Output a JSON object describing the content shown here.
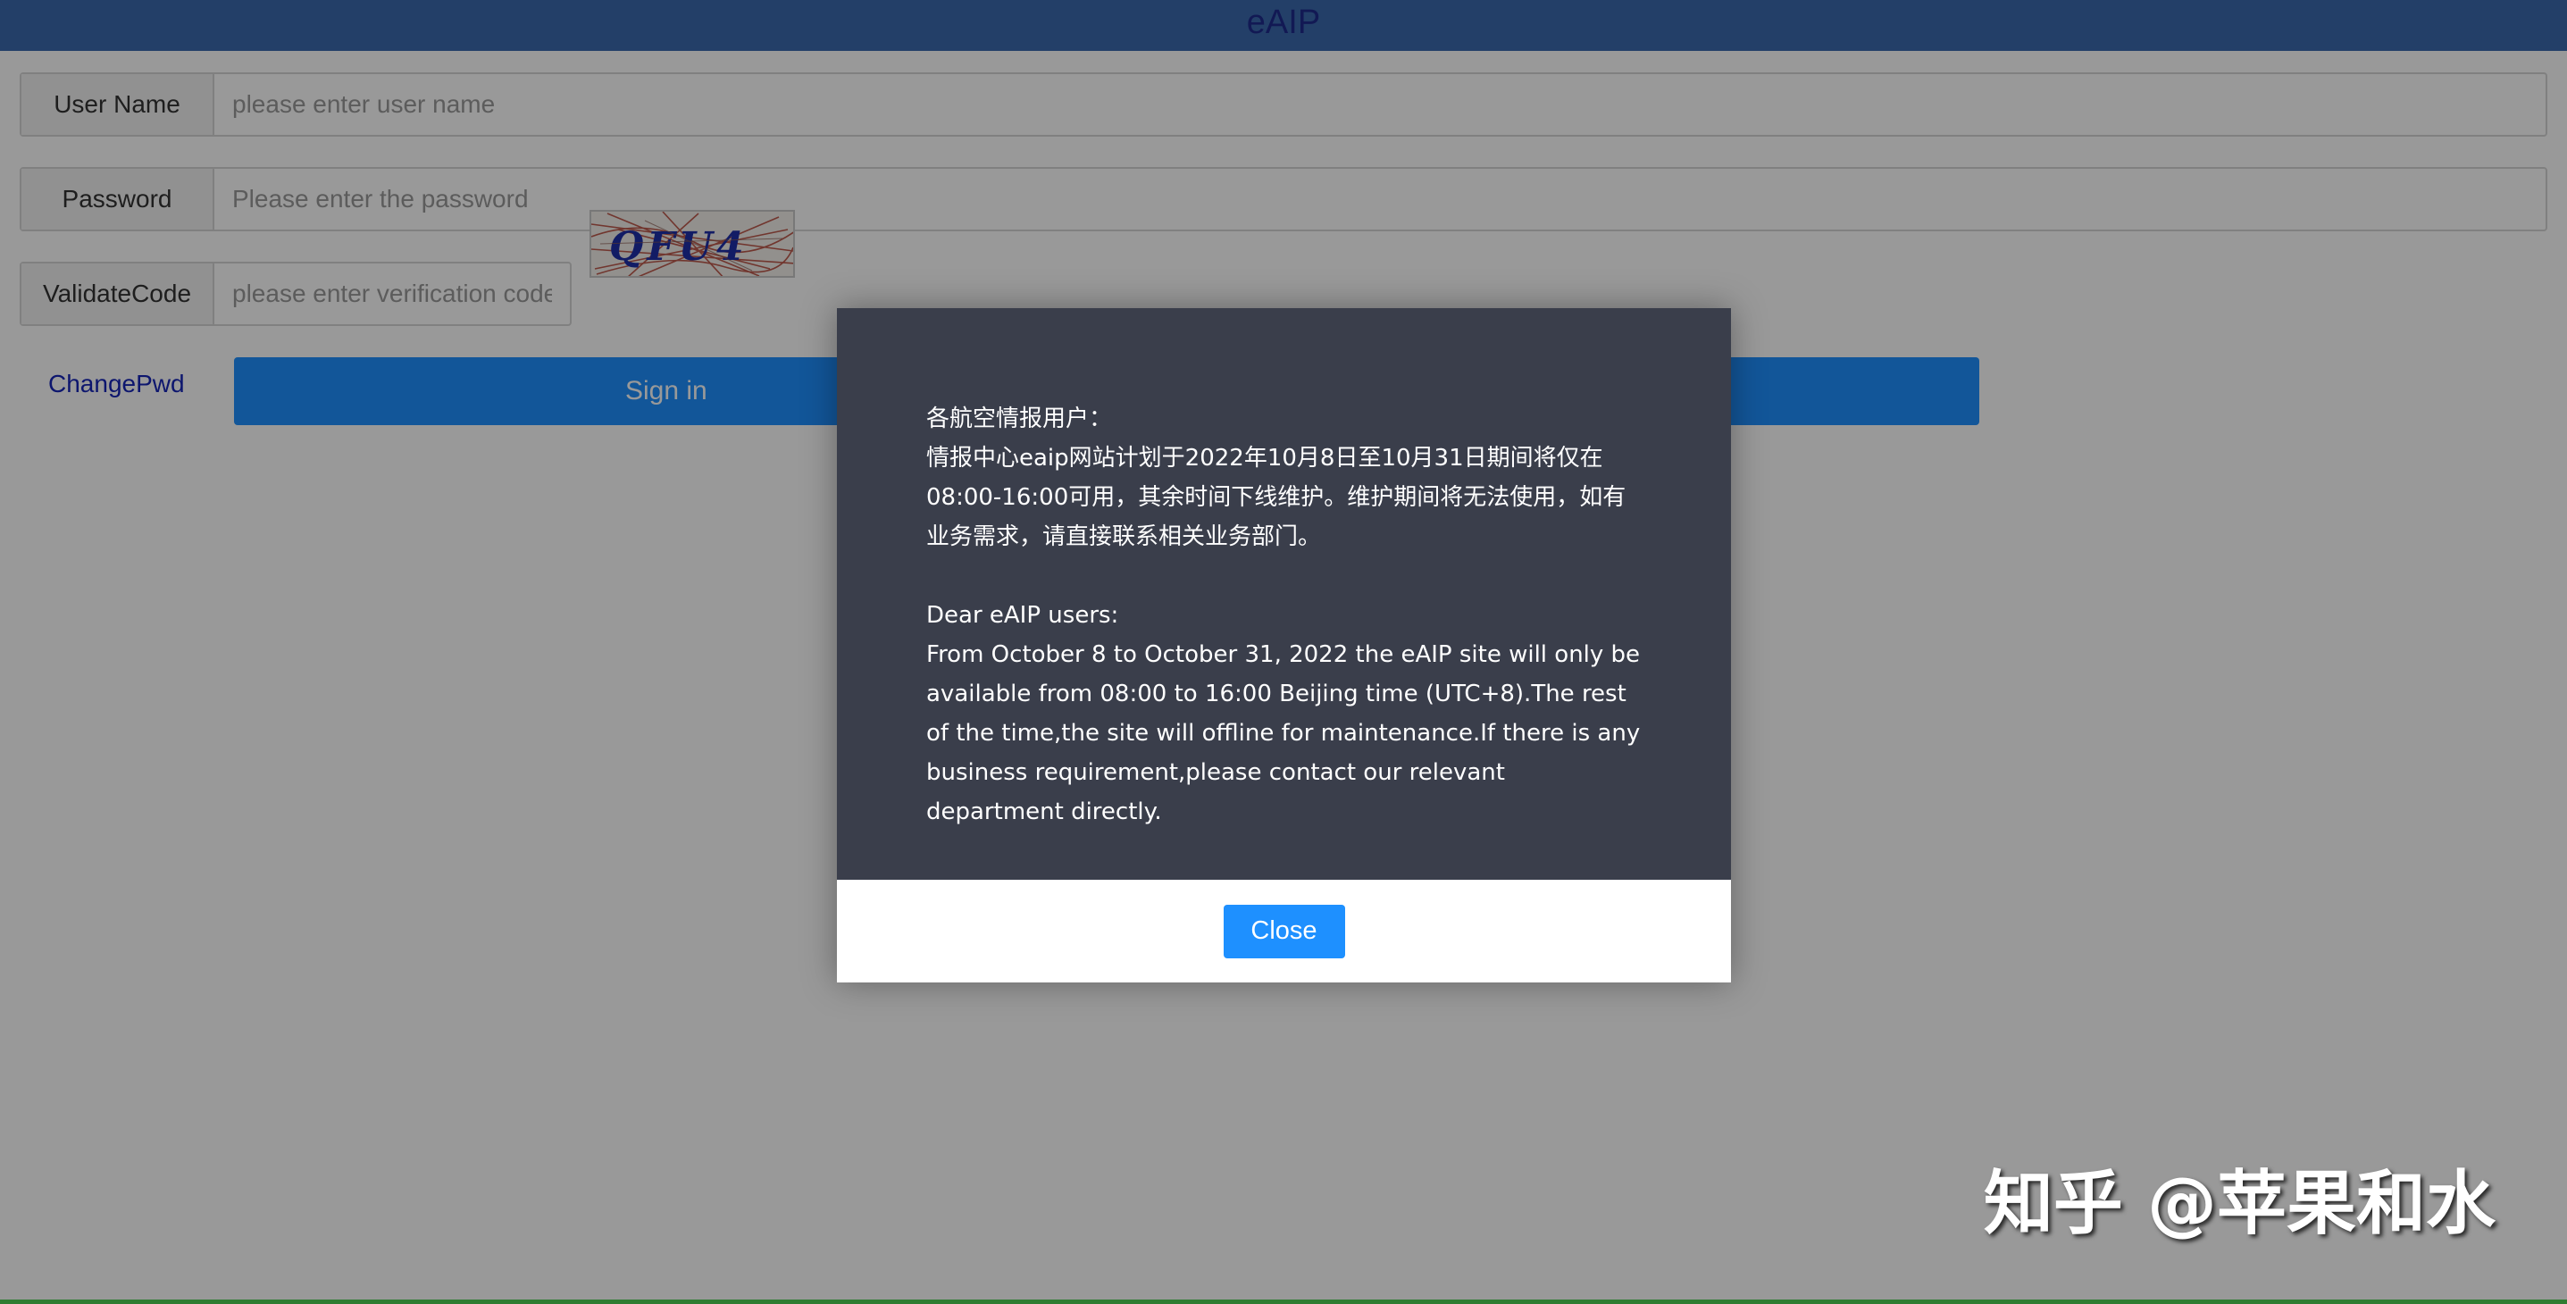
{
  "header": {
    "title": "eAIP"
  },
  "login": {
    "username": {
      "label": "User Name",
      "placeholder": "please enter user name"
    },
    "password": {
      "label": "Password",
      "placeholder": "Please enter the password"
    },
    "validate": {
      "label": "ValidateCode",
      "placeholder": "please enter verification code",
      "captcha_text": "QFU4"
    },
    "changepwd_label": "ChangePwd",
    "signin_label": "Sign in"
  },
  "modal": {
    "zh_greeting": "各航空情报用户：",
    "zh_body": "情报中心eaip网站计划于2022年10月8日至10月31日期间将仅在08:00-16:00可用，其余时间下线维护。维护期间将无法使用，如有业务需求，请直接联系相关业务部门。",
    "en_greeting": "Dear eAIP users:",
    "en_body": "From October 8 to October 31, 2022 the eAIP site will only be available from 08:00 to 16:00 Beijing time (UTC+8).The rest of the time,the site will offline for maintenance.If there is any business requirement,please contact our relevant department directly.",
    "close_label": "Close"
  },
  "watermark": "知乎 @苹果和水",
  "colors": {
    "header_bg": "#3b6aae",
    "primary_button": "#1f90ff",
    "modal_body_bg": "#3a3e4b",
    "link": "#1726b8"
  }
}
